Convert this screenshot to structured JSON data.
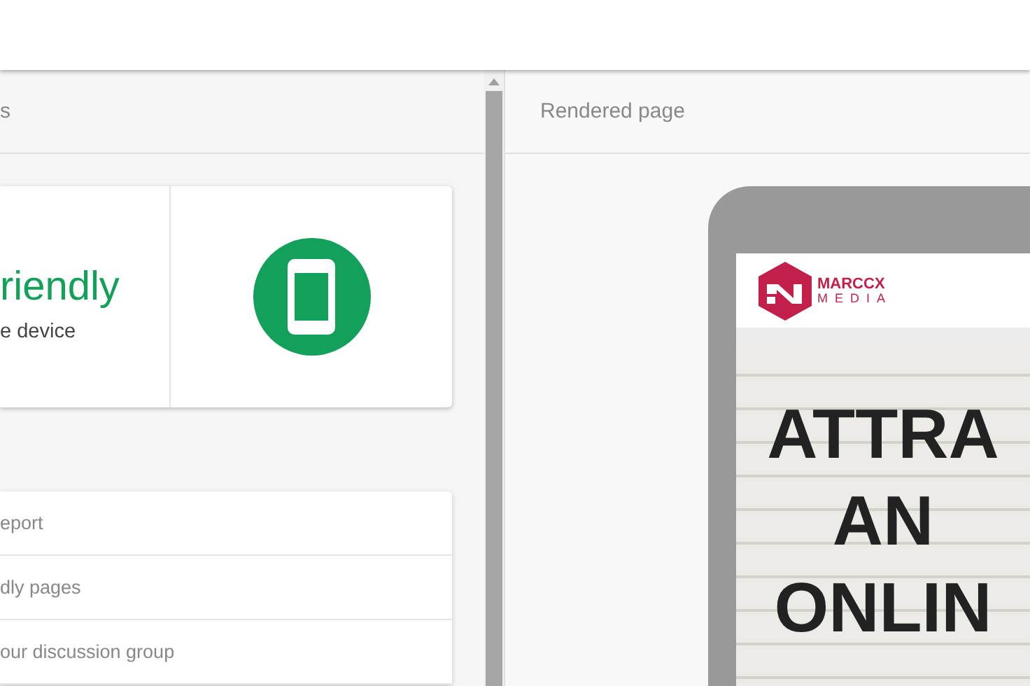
{
  "left_panel": {
    "header": "s",
    "result": {
      "title": "riendly",
      "subtitle": "e device"
    },
    "links": [
      {
        "label": "eport"
      },
      {
        "label": "dly pages"
      },
      {
        "label": "our discussion group"
      }
    ]
  },
  "right_panel": {
    "header": "Rendered page",
    "site": {
      "logo_top": "MARCCX",
      "logo_bottom": "MEDIA",
      "headline": [
        "ATTRA",
        "AN",
        "ONLIN"
      ]
    }
  }
}
